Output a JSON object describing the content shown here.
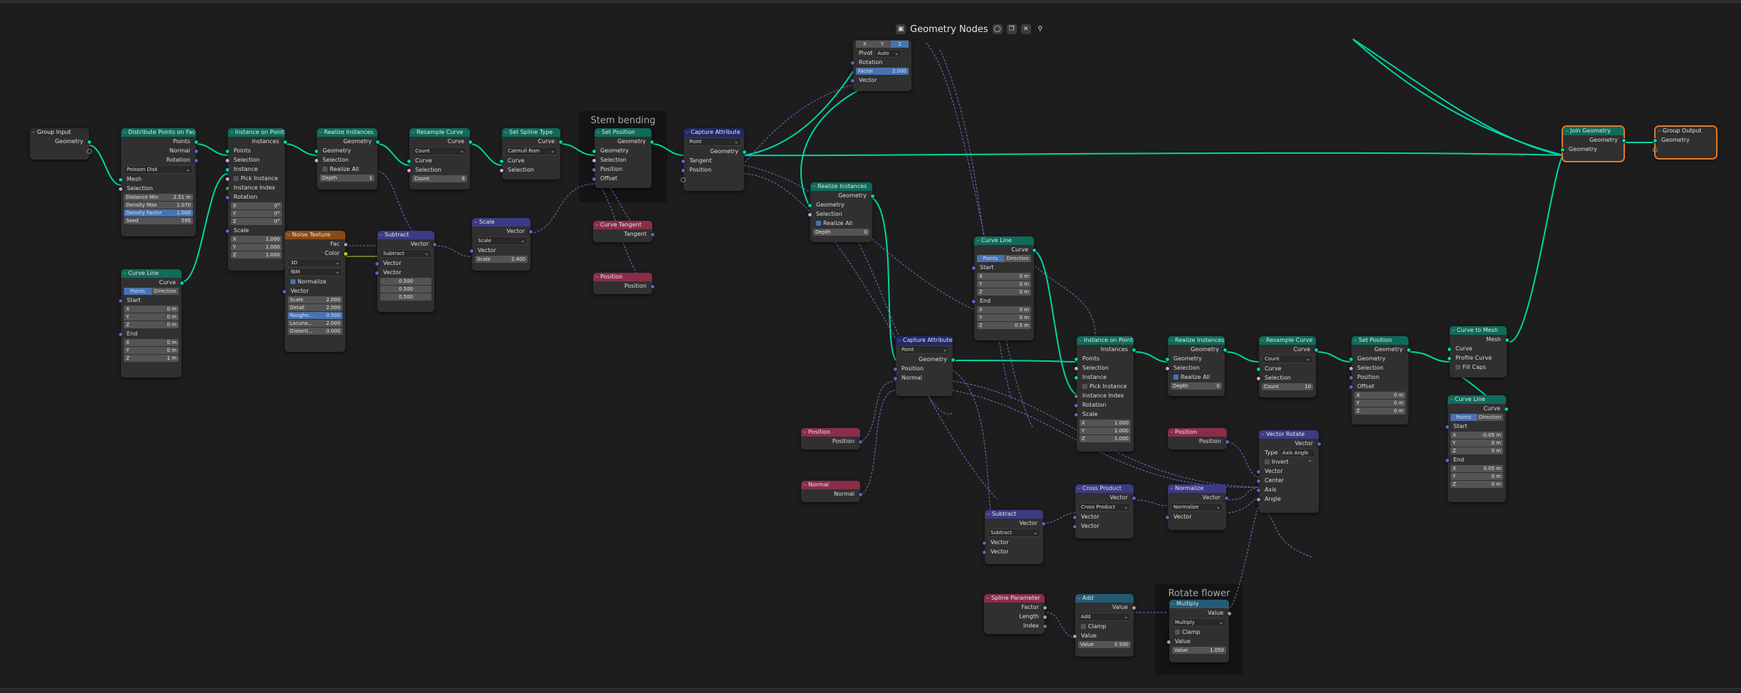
{
  "editor": {
    "title": "Geometry Nodes"
  },
  "frames": {
    "stem": "Stem bending",
    "leaves": "Rotate flower leaves"
  },
  "nodes": {
    "group_input": {
      "title": "Group Input",
      "geometry": "Geometry"
    },
    "group_output": {
      "title": "Group Output",
      "geometry": "Geometry"
    },
    "distribute": {
      "title": "Distribute Points on Faces",
      "points": "Points",
      "normal": "Normal",
      "rotation": "Rotation",
      "mode": "Poisson Disk",
      "mesh": "Mesh",
      "selection": "Selection",
      "dist_label": "Distance Min",
      "dist_val": "2.51 m",
      "dmax_label": "Density Max",
      "dmax_val": "1.070",
      "dfac_label": "Density Factor",
      "dfac_val": "1.000",
      "seed_label": "Seed",
      "seed_val": "595"
    },
    "instance_points_1": {
      "title": "Instance on Points",
      "instances": "Instances",
      "points": "Points",
      "selection": "Selection",
      "instance": "Instance",
      "pick": "Pick Instance",
      "index": "Instance Index",
      "rotation": "Rotation",
      "rx": "0°",
      "ry": "0°",
      "rz": "0°",
      "scale": "Scale",
      "sx": "1.000",
      "sy": "1.000",
      "sz": "1.000"
    },
    "realize_1": {
      "title": "Realize Instances",
      "geometry_out": "Geometry",
      "geometry_in": "Geometry",
      "selection": "Selection",
      "realize_all": "Realize All",
      "depth_label": "Depth",
      "depth_val": "1"
    },
    "resample_1": {
      "title": "Resample Curve",
      "curve_out": "Curve",
      "mode": "Count",
      "curve_in": "Curve",
      "selection": "Selection",
      "count_label": "Count",
      "count_val": "8"
    },
    "spline_type": {
      "title": "Set Spline Type",
      "curve_out": "Curve",
      "mode": "Catmull Rom",
      "curve_in": "Curve",
      "selection": "Selection"
    },
    "set_position_1": {
      "title": "Set Position",
      "geometry_out": "Geometry",
      "geometry_in": "Geometry",
      "selection": "Selection",
      "position": "Position",
      "offset": "Offset"
    },
    "capture_1": {
      "title": "Capture Attribute",
      "domain": "Point",
      "geometry_out": "Geometry",
      "tangent": "Tangent",
      "position": "Position"
    },
    "vector_rotate_top": {
      "pivot_label": "Pivot",
      "pivot_val": "Auto",
      "rotation": "Rotation",
      "factor_label": "Factor",
      "factor_val": "2.000",
      "vector": "Vector",
      "x": "X",
      "y": "Y",
      "z": "Z"
    },
    "curve_line_1": {
      "title": "Curve Line",
      "curve": "Curve",
      "m1": "Points",
      "m2": "Direction",
      "start": "Start",
      "sx": "0 m",
      "sy": "0 m",
      "sz": "0 m",
      "end": "End",
      "ex": "0 m",
      "ey": "0 m",
      "ez": "1 m"
    },
    "noise": {
      "title": "Noise Texture",
      "fac": "Fac",
      "color": "Color",
      "dim": "3D",
      "type": "fBM",
      "normalize": "Normalize",
      "vector": "Vector",
      "scale_l": "Scale",
      "scale_v": "2.000",
      "detail_l": "Detail",
      "detail_v": "2.000",
      "rough_l": "Roughn...",
      "rough_v": "0.500",
      "lac_l": "Lacuna...",
      "lac_v": "2.000",
      "dist_l": "Distorti...",
      "dist_v": "0.000"
    },
    "subtract_1": {
      "title": "Subtract",
      "vector": "Vector",
      "op": "Subtract",
      "vin": "Vector",
      "vin2": "Vector",
      "v1": "0.500",
      "v2": "0.500",
      "v3": "0.500"
    },
    "scale_node": {
      "title": "Scale",
      "vector": "Vector",
      "op": "Scale",
      "vin": "Vector",
      "scale_l": "Scale",
      "scale_v": "2.400"
    },
    "curve_tangent": {
      "title": "Curve Tangent",
      "tangent": "Tangent"
    },
    "position_1": {
      "title": "Position",
      "position": "Position"
    },
    "realize_2": {
      "title": "Realize Instances",
      "geometry_out": "Geometry",
      "geometry_in": "Geometry",
      "selection": "Selection",
      "realize_all": "Realize All",
      "depth_label": "Depth",
      "depth_val": "0"
    },
    "curve_line_2": {
      "title": "Curve Line",
      "curve": "Curve",
      "m1": "Points",
      "m2": "Direction",
      "start": "Start",
      "sx": "0 m",
      "sy": "0 m",
      "sz": "0 m",
      "end": "End",
      "ex": "0 m",
      "ey": "0 m",
      "ez": "0.5 m"
    },
    "capture_2": {
      "title": "Capture Attribute",
      "domain": "Point",
      "geometry_out": "Geometry",
      "position": "Position",
      "normal": "Normal"
    },
    "position_2": {
      "title": "Position",
      "position": "Position"
    },
    "normal_node": {
      "title": "Normal",
      "normal": "Normal"
    },
    "instance_points_2": {
      "title": "Instance on Points",
      "instances": "Instances",
      "points": "Points",
      "selection": "Selection",
      "instance": "Instance",
      "pick": "Pick Instance",
      "index": "Instance Index",
      "rotation": "Rotation",
      "scale": "Scale",
      "sx": "1.000",
      "sy": "1.000",
      "sz": "1.000"
    },
    "realize_3": {
      "title": "Realize Instances",
      "geometry_out": "Geometry",
      "geometry_in": "Geometry",
      "selection": "Selection",
      "realize_all": "Realize All",
      "depth_label": "Depth",
      "depth_val": "0"
    },
    "resample_2": {
      "title": "Resample Curve",
      "curve_out": "Curve",
      "mode": "Count",
      "curve_in": "Curve",
      "selection": "Selection",
      "count_label": "Count",
      "count_val": "10"
    },
    "set_position_2": {
      "title": "Set Position",
      "geometry_out": "Geometry",
      "geometry_in": "Geometry",
      "selection": "Selection",
      "position": "Position",
      "offset": "Offset",
      "x": "0 m",
      "y": "0 m",
      "z": "0 m"
    },
    "curve_to_mesh": {
      "title": "Curve to Mesh",
      "mesh": "Mesh",
      "curve": "Curve",
      "profile": "Profile Curve",
      "fill": "Fill Caps"
    },
    "curve_line_3": {
      "title": "Curve Line",
      "curve": "Curve",
      "m1": "Points",
      "m2": "Direction",
      "start": "Start",
      "sx": "-0.05 m",
      "sy": "0 m",
      "sz": "0 m",
      "end": "End",
      "ex": "0.05 m",
      "ey": "0 m",
      "ez": "0 m"
    },
    "join": {
      "title": "Join Geometry",
      "geometry_out": "Geometry",
      "geometry_in": "Geometry"
    },
    "position_3": {
      "title": "Position",
      "position": "Position"
    },
    "vector_rotate": {
      "title": "Vector Rotate",
      "vector_out": "Vector",
      "type_l": "Type",
      "type_v": "Axis Angle",
      "invert": "Invert",
      "vector": "Vector",
      "center": "Center",
      "axis": "Axis",
      "angle": "Angle"
    },
    "cross": {
      "title": "Cross Product",
      "vector": "Vector",
      "op": "Cross Product",
      "v1": "Vector",
      "v2": "Vector"
    },
    "normalize": {
      "title": "Normalize",
      "vector": "Vector",
      "op": "Normalize",
      "vin": "Vector"
    },
    "subtract_2": {
      "title": "Subtract",
      "vector": "Vector",
      "op": "Subtract",
      "v1": "Vector",
      "v2": "Vector"
    },
    "spline_param": {
      "title": "Spline Parameter",
      "factor": "Factor",
      "length": "Length",
      "index": "Index"
    },
    "add": {
      "title": "Add",
      "value": "Value",
      "op": "Add",
      "clamp": "Clamp",
      "vin": "Value",
      "v_l": "Value",
      "v_v": "0.500"
    },
    "multiply": {
      "title": "Multiply",
      "value": "Value",
      "op": "Multiply",
      "clamp": "Clamp",
      "vin": "Value",
      "v_l": "Value",
      "v_v": "1.050"
    }
  },
  "colors": {
    "geometry_link": "#00d6a3",
    "vector_link": "#6363c7",
    "active_outline": "#e07a2b"
  }
}
